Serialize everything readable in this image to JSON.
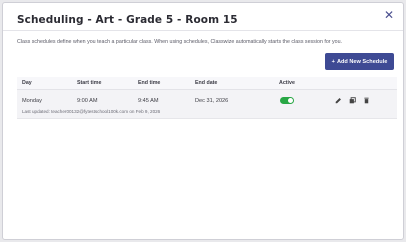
{
  "modal": {
    "title": "Scheduling - Art - Grade 5 - Room 15",
    "close_icon": "✕",
    "description": "Class schedules define when you teach a particular class. When using schedules, Classwize automatically starts the class session for you.",
    "add_button": {
      "icon": "+",
      "label": "Add New Schedule"
    }
  },
  "table": {
    "headers": [
      "Day",
      "Start time",
      "End time",
      "End date",
      "Active"
    ],
    "rows": [
      {
        "day": "Monday",
        "start_time": "9:00 AM",
        "end_time": "9:45 AM",
        "end_date": "Dec 31, 2026",
        "active": true,
        "last_updated": "Last updated: teacher00132@fytestschool100k.com on Feb 9, 2026"
      }
    ]
  },
  "icons": {
    "edit": "edit-icon",
    "copy": "copy-icon",
    "delete": "delete-icon"
  },
  "colors": {
    "accent": "#3e4a94",
    "toggle_on": "#28a745"
  }
}
